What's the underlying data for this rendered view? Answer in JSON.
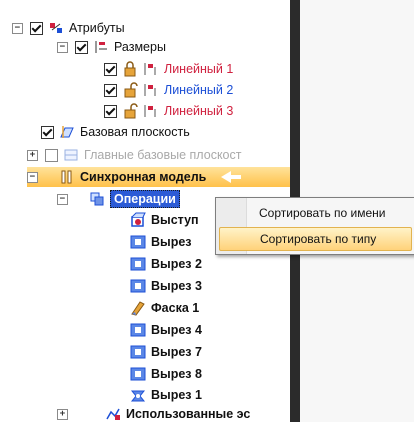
{
  "tree": {
    "attributes": "Атрибуты",
    "dimensions": "Размеры",
    "linear_1": "Линейный 1",
    "linear_2": "Линейный 2",
    "linear_3": "Линейный 3",
    "base_plane": "Базовая плоскость",
    "main_base_planes": "Главные базовые плоскост",
    "sync_model": "Синхронная модель",
    "operations": "Операции",
    "extrude": "Выступ",
    "cut": "Вырез",
    "cut_2": "Вырез 2",
    "cut_3": "Вырез 3",
    "chamfer_1": "Фаска 1",
    "cut_4": "Вырез 4",
    "cut_7": "Вырез 7",
    "cut_8": "Вырез 8",
    "cut_1": "Вырез 1",
    "used_sketches": "Использованные эс"
  },
  "context_menu": {
    "sort_by_name": "Сортировать по имени",
    "sort_by_type": "Сортировать по типу"
  },
  "colors": {
    "highlight": "#ffc14a",
    "selection": "#2c5bd6",
    "dimension_red": "#d0213f",
    "dimension_blue": "#1c4fd6"
  }
}
